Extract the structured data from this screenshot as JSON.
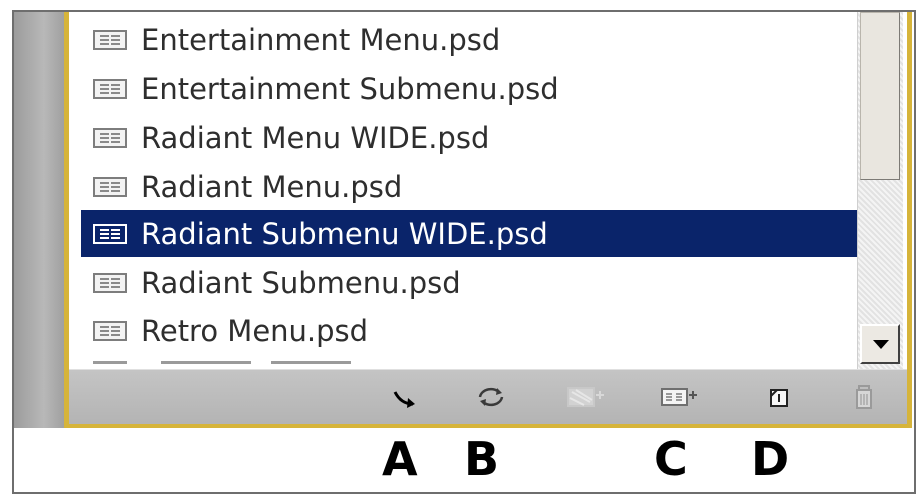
{
  "files": [
    {
      "name": "Entertainment Menu.psd",
      "selected": false
    },
    {
      "name": "Entertainment Submenu.psd",
      "selected": false
    },
    {
      "name": "Radiant Menu WIDE.psd",
      "selected": false
    },
    {
      "name": "Radiant Menu.psd",
      "selected": false
    },
    {
      "name": "Radiant Submenu WIDE.psd",
      "selected": true
    },
    {
      "name": "Radiant Submenu.psd",
      "selected": false
    },
    {
      "name": "Retro Menu.psd",
      "selected": false
    }
  ],
  "toolbar": {
    "buttons": [
      {
        "icon": "go-to-arrow-icon",
        "enabled": true
      },
      {
        "icon": "refresh-icon",
        "enabled": true
      },
      {
        "icon": "apply-menu-icon",
        "enabled": false
      },
      {
        "icon": "apply-submenu-icon",
        "enabled": true
      },
      {
        "icon": "new-page-icon",
        "enabled": true
      },
      {
        "icon": "trash-icon",
        "enabled": false
      }
    ]
  },
  "captions": {
    "a": "A",
    "b": "B",
    "c": "C",
    "d": "D"
  },
  "colors": {
    "selection": "#0a246a",
    "panel_border": "#d6b43a",
    "toolbar": "#bcbcbc"
  }
}
